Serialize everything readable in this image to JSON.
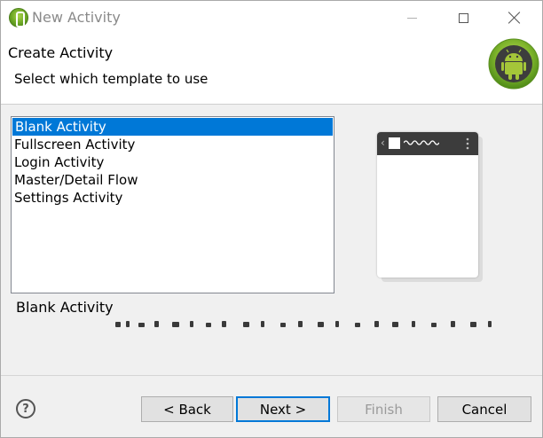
{
  "window": {
    "title": "New Activity"
  },
  "header": {
    "title": "Create Activity",
    "subtitle": "Select which template to use"
  },
  "templates": {
    "items": [
      {
        "label": "Blank Activity",
        "selected": true
      },
      {
        "label": "Fullscreen Activity",
        "selected": false
      },
      {
        "label": "Login Activity",
        "selected": false
      },
      {
        "label": "Master/Detail Flow",
        "selected": false
      },
      {
        "label": "Settings Activity",
        "selected": false
      }
    ]
  },
  "description": {
    "title": "Blank Activity"
  },
  "buttons": {
    "help": "?",
    "back": "< Back",
    "next": "Next >",
    "finish": "Finish",
    "cancel": "Cancel"
  },
  "colors": {
    "selection": "#0078d7",
    "android_green": "#a4c639",
    "preview_bar": "#3c3c3c"
  },
  "icons": {
    "app": "android-adt-icon",
    "logo": "android-logo-icon",
    "help": "help-circle-icon"
  }
}
